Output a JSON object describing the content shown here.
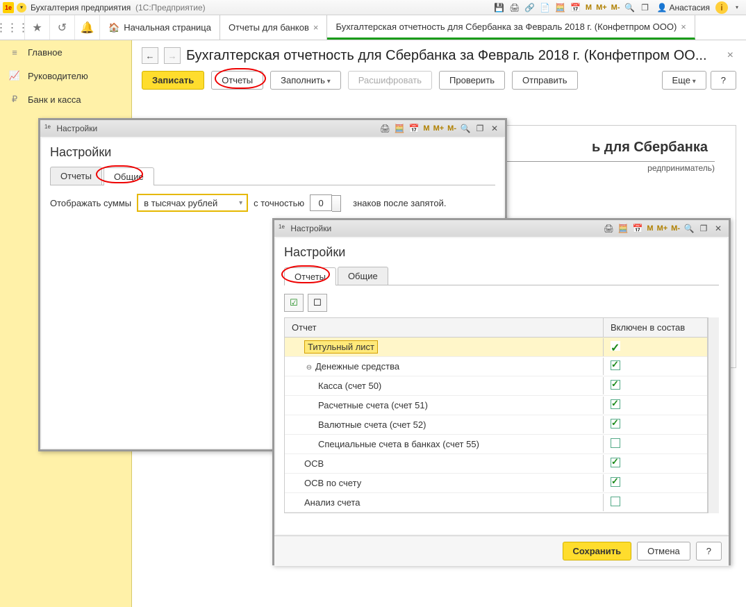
{
  "titlebar": {
    "app": "Бухгалтерия предприятия",
    "platform": "(1С:Предприятие)",
    "user": "Анастасия"
  },
  "memory_labels": {
    "m": "M",
    "mp": "M+",
    "mm": "M-"
  },
  "tabs": {
    "home": "Начальная страница",
    "t1": "Отчеты для банков",
    "t2": "Бухгалтерская отчетность для Сбербанка за Февраль 2018 г. (Конфетпром ООО)"
  },
  "sidebar": {
    "items": [
      "Главное",
      "Руководителю",
      "Банк и касса"
    ]
  },
  "main": {
    "title": "Бухгалтерская отчетность для Сбербанка за Февраль 2018 г. (Конфетпром ОО...",
    "buttons": {
      "save": "Записать",
      "reports": "Отчеты",
      "fill": "Заполнить",
      "decode": "Расшифровать",
      "check": "Проверить",
      "send": "Отправить",
      "more": "Еще",
      "help": "?"
    }
  },
  "preview": {
    "title": "ь для Сбербанка",
    "sub": "редприниматель)"
  },
  "dialog1": {
    "title": "Настройки",
    "heading": "Настройки",
    "tabs": {
      "reports": "Отчеты",
      "common": "Общие"
    },
    "label_show": "Отображать суммы",
    "select_value": "в тысячах рублей",
    "label_prec": "с точностью",
    "prec_value": "0",
    "label_after": "знаков после запятой."
  },
  "dialog2": {
    "title": "Настройки",
    "heading": "Настройки",
    "tabs": {
      "reports": "Отчеты",
      "common": "Общие"
    },
    "grid": {
      "col1": "Отчет",
      "col2": "Включен в состав",
      "rows": [
        {
          "label": "Титульный лист",
          "indent": 1,
          "hl": true,
          "tick": "plain"
        },
        {
          "label": "Денежные средства",
          "indent": 1,
          "exp": true,
          "tick": "on"
        },
        {
          "label": "Касса (счет 50)",
          "indent": 2,
          "tick": "on"
        },
        {
          "label": "Расчетные счета (счет 51)",
          "indent": 2,
          "tick": "on"
        },
        {
          "label": "Валютные счета (счет 52)",
          "indent": 2,
          "tick": "on"
        },
        {
          "label": "Специальные счета в банках (счет 55)",
          "indent": 2,
          "tick": "off"
        },
        {
          "label": "ОСВ",
          "indent": 1,
          "tick": "on"
        },
        {
          "label": "ОСВ по счету",
          "indent": 1,
          "tick": "on"
        },
        {
          "label": "Анализ счета",
          "indent": 1,
          "tick": "off"
        }
      ]
    },
    "footer": {
      "save": "Сохранить",
      "cancel": "Отмена",
      "help": "?"
    }
  }
}
